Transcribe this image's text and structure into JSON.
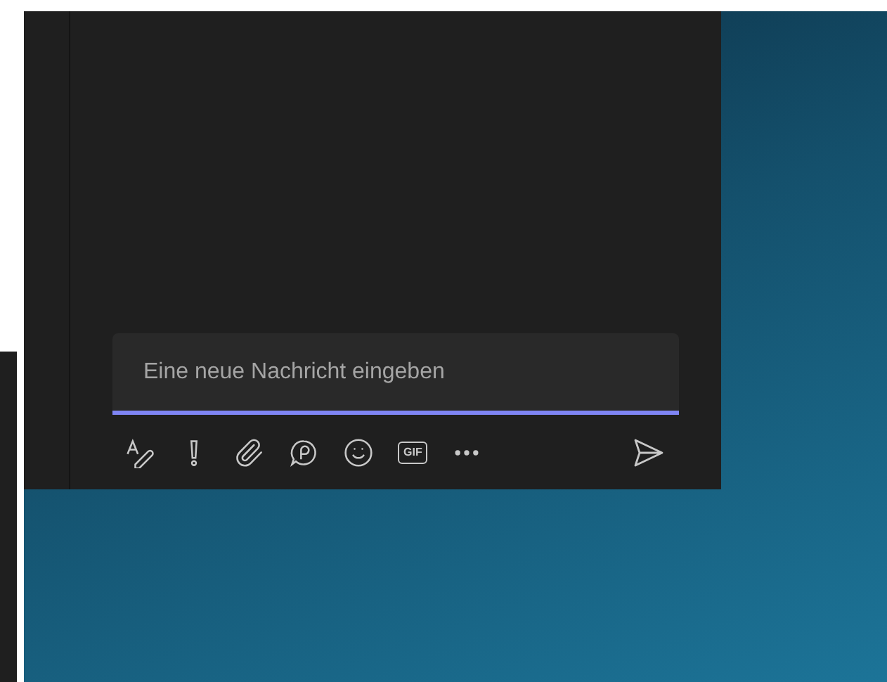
{
  "compose": {
    "placeholder": "Eine neue Nachricht eingeben"
  },
  "toolbar": [
    {
      "kind": "format"
    },
    {
      "kind": "important"
    },
    {
      "kind": "attach"
    },
    {
      "kind": "loop"
    },
    {
      "kind": "emoji"
    },
    {
      "kind": "gif",
      "label": "GIF"
    },
    {
      "kind": "more"
    }
  ]
}
